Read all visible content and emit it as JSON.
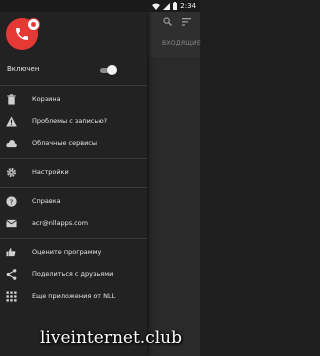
{
  "status_bar": {
    "time": "2:34"
  },
  "background": {
    "tab_label": "ВХОДЯЩИЕ"
  },
  "drawer": {
    "toggle_label": "Включен",
    "group1": [
      {
        "label": "Корзина",
        "icon": "trash-icon"
      },
      {
        "label": "Проблемы с записью?",
        "icon": "warning-icon"
      },
      {
        "label": "Облачные сервисы",
        "icon": "cloud-icon"
      }
    ],
    "group2": [
      {
        "label": "Настройки",
        "icon": "gear-icon"
      }
    ],
    "group3": [
      {
        "label": "Справка",
        "icon": "help-icon"
      },
      {
        "label": "acr@nllapps.com",
        "icon": "email-icon"
      }
    ],
    "group4": [
      {
        "label": "Оцените программу",
        "icon": "thumbs-icon"
      },
      {
        "label": "Поделиться с друзьями",
        "icon": "share-icon"
      },
      {
        "label": "Еще приложения от NLL",
        "icon": "grid-icon"
      }
    ]
  },
  "watermark": "liveinternet.club",
  "colors": {
    "accent": "#e53935",
    "drawer_bg": "#222222",
    "text": "#e6e6e6"
  }
}
